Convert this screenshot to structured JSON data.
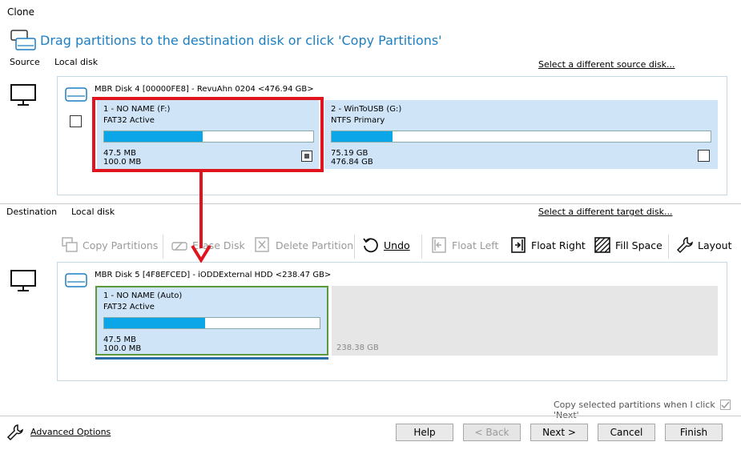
{
  "window": {
    "title": "Clone"
  },
  "header": {
    "instruction": "Drag partitions to the destination disk or click 'Copy Partitions'"
  },
  "source": {
    "label": "Source",
    "sublabel": "Local disk",
    "select_link": "Select a different source disk...",
    "disk_header": "MBR Disk 4 [00000FE8] - RevuAhn  0204  <476.94 GB>",
    "partitions": [
      {
        "name": "1 - NO NAME (F:)",
        "type": "FAT32 Active",
        "used": "47.5 MB",
        "total": "100.0 MB",
        "fill": 0.47
      },
      {
        "name": "2 - WinToUSB (G:)",
        "type": "NTFS Primary",
        "used": "75.19 GB",
        "total": "476.84 GB",
        "fill": 0.16
      }
    ]
  },
  "destination": {
    "label": "Destination",
    "sublabel": "Local disk",
    "select_link": "Select a different target disk...",
    "disk_header": "MBR Disk 5 [4F8EFCED] - iODD",
    "disk_type": "External HDD  <238.47 GB>",
    "partitions": [
      {
        "name": "1 - NO NAME (Auto)",
        "type": "FAT32 Active",
        "used": "47.5 MB",
        "total": "100.0 MB",
        "fill": 0.47
      }
    ],
    "free_space": "238.38 GB"
  },
  "toolbar": {
    "copy_partitions": "Copy Partitions",
    "erase_disk": "Erase Disk",
    "delete_partition": "Delete Partition",
    "undo": "Undo",
    "float_left": "Float Left",
    "float_right": "Float Right",
    "fill_space": "Fill Space",
    "layout": "Layout"
  },
  "copy_option": "Copy selected partitions when I click 'Next'",
  "footer": {
    "advanced_options": "Advanced Options",
    "help": "Help",
    "back": "< Back",
    "next": "Next >",
    "cancel": "Cancel",
    "finish": "Finish"
  },
  "colors": {
    "accent": "#1b7fc4",
    "highlight": "#e0141e",
    "bar": "#0aa6e8",
    "partition_bg": "#cfe4f6",
    "dest_border": "#5a9a3a"
  }
}
